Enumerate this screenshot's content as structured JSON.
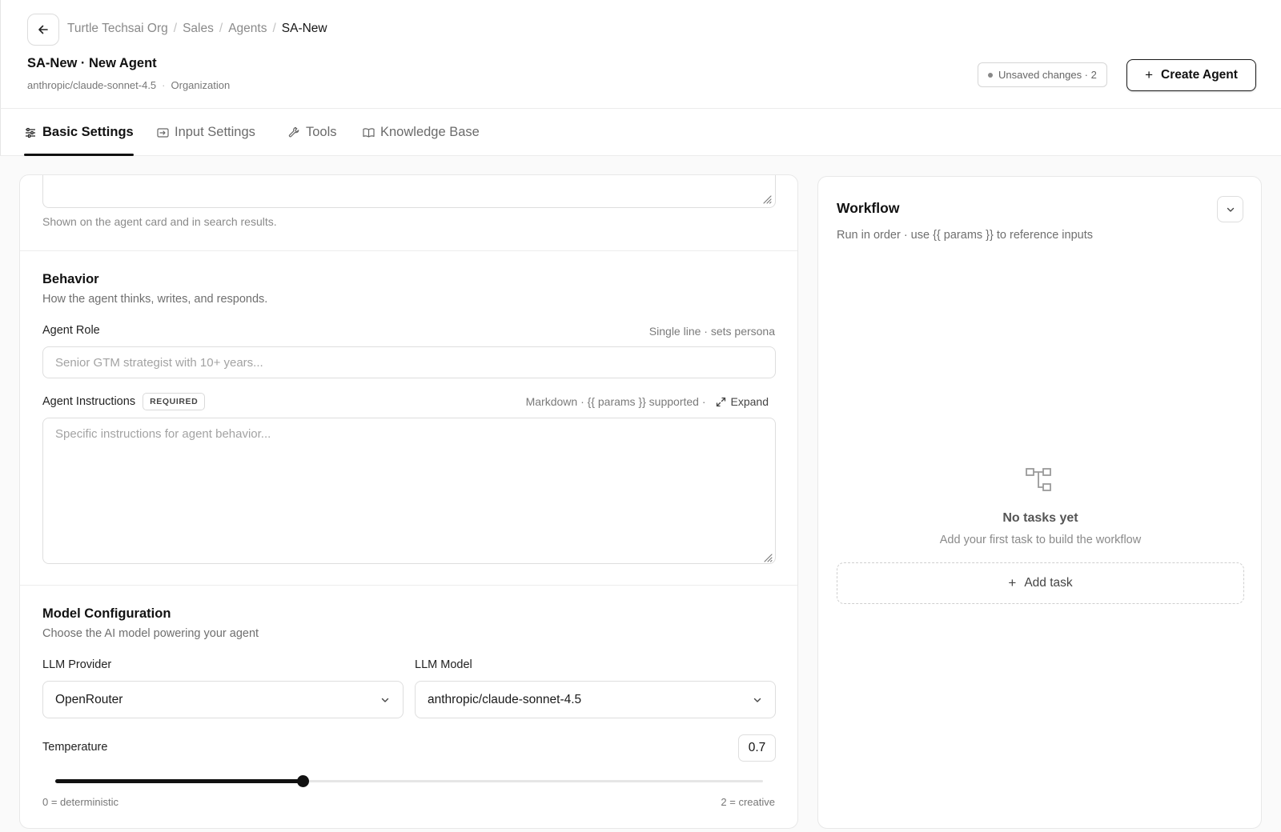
{
  "header": {
    "breadcrumb": [
      "Turtle Techsai Org",
      "Sales",
      "Agents",
      "SA-New"
    ],
    "title": "SA-New · New Agent",
    "model": "anthropic/claude-sonnet-4.5",
    "scope": "Organization",
    "unsaved_label": "Unsaved changes · 2",
    "create_label": "Create Agent"
  },
  "tabs": [
    {
      "label": "Basic Settings",
      "icon": "sliders-icon",
      "active": true
    },
    {
      "label": "Input Settings",
      "icon": "input-icon",
      "active": false
    },
    {
      "label": "Tools",
      "icon": "wrench-icon",
      "active": false
    },
    {
      "label": "Knowledge Base",
      "icon": "book-icon",
      "active": false
    }
  ],
  "description": {
    "hint": "Shown on the agent card and in search results."
  },
  "behavior": {
    "title": "Behavior",
    "subtitle": "How the agent thinks, writes, and responds.",
    "role_label": "Agent Role",
    "role_meta": "Single line · sets persona",
    "role_value": "",
    "role_placeholder": "Senior GTM strategist with 10+ years...",
    "instructions_label": "Agent Instructions",
    "required_badge": "REQUIRED",
    "instructions_meta": "Markdown · {{ params }} supported ·",
    "expand_label": "Expand",
    "instructions_value": "",
    "instructions_placeholder": "Specific instructions for agent behavior..."
  },
  "model_config": {
    "title": "Model Configuration",
    "subtitle": "Choose the AI model powering your agent",
    "provider_label": "LLM Provider",
    "provider_value": "OpenRouter",
    "model_label": "LLM Model",
    "model_value": "anthropic/claude-sonnet-4.5",
    "temperature_label": "Temperature",
    "temperature_value": "0.7",
    "temperature_min": 0,
    "temperature_max": 2,
    "temperature_fraction": 0.35,
    "min_label": "0 = deterministic",
    "max_label": "2 = creative"
  },
  "workflow": {
    "title": "Workflow",
    "subtitle": "Run in order · use {{ params }} to reference inputs",
    "empty_title": "No tasks yet",
    "empty_subtitle": "Add your first task to build the workflow",
    "add_task_label": "Add task"
  }
}
